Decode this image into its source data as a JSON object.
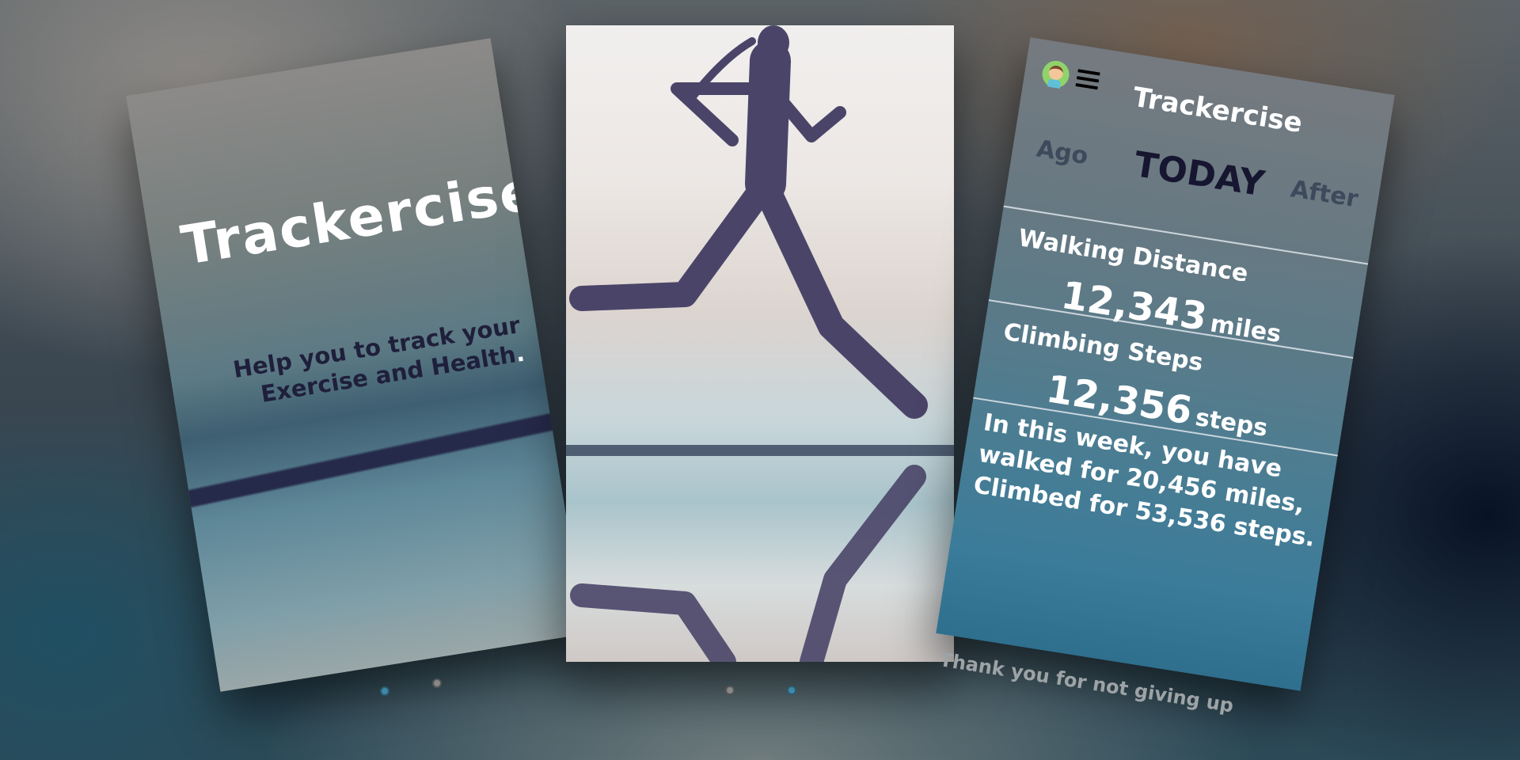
{
  "screens": {
    "splash": {
      "title": "Trackercise",
      "subtitle_line1": "Help you to track your",
      "subtitle_line2": "Exercise and Health",
      "subtitle_period": "."
    },
    "dashboard": {
      "title": "Trackercise",
      "nav": {
        "prev": "Ago",
        "current": "TODAY",
        "next": "After"
      },
      "walking": {
        "label": "Walking Distance",
        "value": "12,343",
        "unit": "miles"
      },
      "climbing": {
        "label": "Climbing Steps",
        "value": "12,356",
        "unit": "steps"
      },
      "summary": [
        "In this week, you have",
        "walked for 20,456 miles,",
        "Climbed for 53,536 steps."
      ],
      "footer": "Thank you for not giving up"
    }
  },
  "pager": {
    "left_active_index": 0,
    "center_active_index": 1
  },
  "colors": {
    "accent": "#3e8aa6",
    "title_dark": "#161630",
    "silhouette": "#4a4568"
  }
}
